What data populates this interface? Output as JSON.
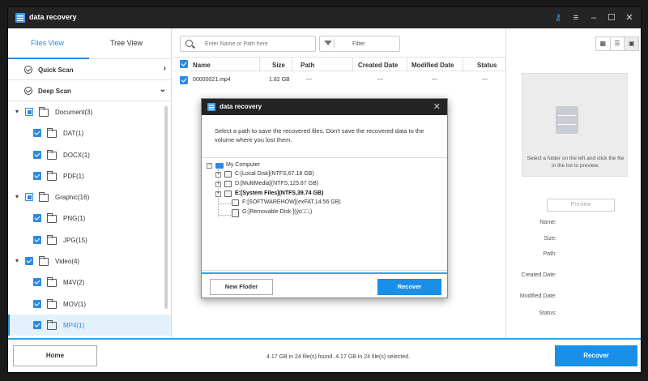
{
  "app": {
    "title": "data recovery"
  },
  "sidebar": {
    "tabs": [
      {
        "label": "Files View"
      },
      {
        "label": "Tree View"
      }
    ],
    "scans": [
      {
        "label": "Quick Scan"
      },
      {
        "label": "Deep Scan"
      }
    ],
    "tree": [
      {
        "label": "Document(3)"
      },
      {
        "label": "DAT(1)"
      },
      {
        "label": "DOCX(1)"
      },
      {
        "label": "PDF(1)"
      },
      {
        "label": "Graphic(16)"
      },
      {
        "label": "PNG(1)"
      },
      {
        "label": "JPG(15)"
      },
      {
        "label": "Video(4)"
      },
      {
        "label": "M4V(2)"
      },
      {
        "label": "MOV(1)"
      },
      {
        "label": "MP4(1)"
      }
    ]
  },
  "search": {
    "placeholder": "Enter Name or Path here"
  },
  "filter": {
    "label": "Filter"
  },
  "table": {
    "columns": [
      "Name",
      "Size",
      "Path",
      "Created Date",
      "Modified Date",
      "Status"
    ],
    "rows": [
      {
        "name": "00000021.mp4",
        "size": "1.82 GB",
        "path": "---",
        "created": "---",
        "modified": "---",
        "status": "---"
      }
    ]
  },
  "preview": {
    "hint": "Select a folder on the left and click the file in the list to preview.",
    "button": "Preview",
    "labels": [
      "Name:",
      "Size:",
      "Path:",
      "Created Date:",
      "Modified Date:",
      "Status:"
    ]
  },
  "bottom": {
    "home": "Home",
    "status": "4.17 GB in 24 file(s) found.   4.17 GB in 24 file(s) selected.",
    "recover": "Recover"
  },
  "dialog": {
    "title": "data recovery",
    "message": "Select a path to save the recovered files. Don't save the recovered data to the volume where you lost them.",
    "tree": {
      "root": "My Computer",
      "drives": [
        {
          "label": "C:[Local Disk](NTFS,67.18 GB)"
        },
        {
          "label": "D:[MultiMedia](NTFS,125.87 GB)"
        },
        {
          "label": "E:[System Files](NTFS,39.74 GB)"
        },
        {
          "label": "F:[SOFTWAREHOW](exFAT,14.56 GB)"
        },
        {
          "label": "G:[Removable Disk ](ýc□□,)"
        }
      ]
    },
    "new_folder": "New Floder",
    "recover": "Recover"
  },
  "colors": {
    "accent": "#1a8fe8",
    "titlebar": "#242424",
    "selection": "#e4f1fc"
  }
}
